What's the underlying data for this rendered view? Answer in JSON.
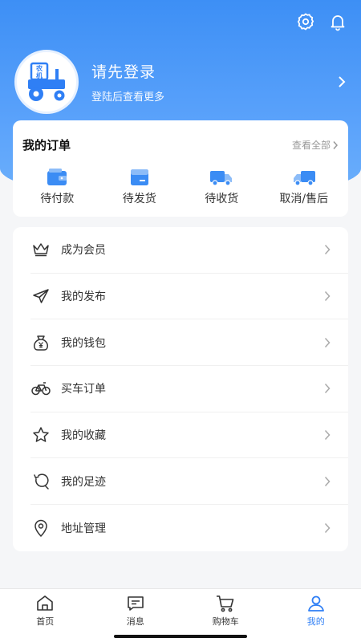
{
  "profile": {
    "title": "请先登录",
    "subtitle": "登陆后查看更多",
    "avatar_text": "农机"
  },
  "orders": {
    "title": "我的订单",
    "view_all": "查看全部",
    "items": [
      {
        "label": "待付款",
        "icon": "wallet-icon"
      },
      {
        "label": "待发货",
        "icon": "package-icon"
      },
      {
        "label": "待收货",
        "icon": "truck-icon"
      },
      {
        "label": "取消/售后",
        "icon": "truck-return-icon"
      }
    ]
  },
  "menu": {
    "items": [
      {
        "label": "成为会员",
        "icon": "crown-icon"
      },
      {
        "label": "我的发布",
        "icon": "send-icon"
      },
      {
        "label": "我的钱包",
        "icon": "money-bag-icon"
      },
      {
        "label": "买车订单",
        "icon": "bicycle-icon"
      },
      {
        "label": "我的收藏",
        "icon": "star-icon"
      },
      {
        "label": "我的足迹",
        "icon": "footprint-icon"
      },
      {
        "label": "地址管理",
        "icon": "location-icon"
      }
    ]
  },
  "tabbar": {
    "items": [
      {
        "label": "首页",
        "icon": "home-icon",
        "active": false
      },
      {
        "label": "消息",
        "icon": "message-icon",
        "active": false
      },
      {
        "label": "购物车",
        "icon": "cart-icon",
        "active": false
      },
      {
        "label": "我的",
        "icon": "user-icon",
        "active": true
      }
    ]
  },
  "colors": {
    "accent": "#2f7ff5",
    "header_gradient_top": "#3d8ff5",
    "header_gradient_bottom": "#6db0fb",
    "page_bg": "#f5f6f8"
  }
}
